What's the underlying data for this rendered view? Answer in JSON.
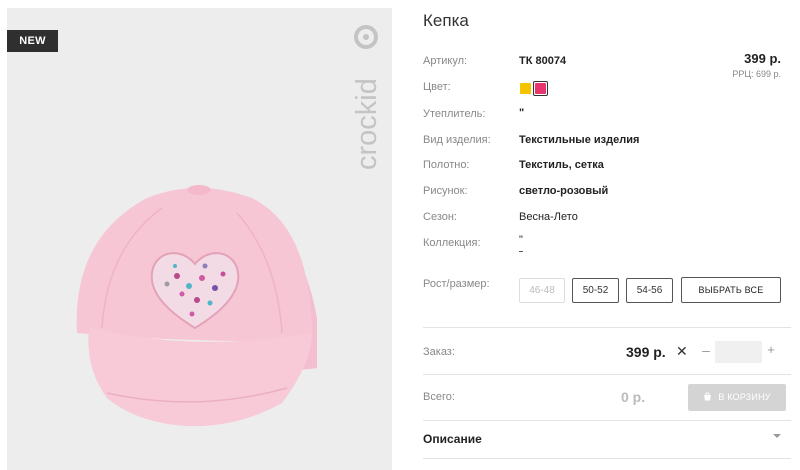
{
  "product": {
    "badge": "NEW",
    "brand": "crockid",
    "title": "Кепка"
  },
  "attributes": [
    {
      "label": "Артикул:",
      "value": "ТК 80074"
    },
    {
      "label": "Цвет:",
      "value": ""
    },
    {
      "label": "Утеплитель:",
      "value": "\""
    },
    {
      "label": "Вид изделия:",
      "value": "Текстильные изделия"
    },
    {
      "label": "Полотно:",
      "value": "Текстиль, сетка"
    },
    {
      "label": "Рисунок:",
      "value": "светло-розовый"
    },
    {
      "label": "Сезон:",
      "value": "Весна-Лето"
    },
    {
      "label": "Коллекция:",
      "value": "\""
    }
  ],
  "colors": [
    "#f5c400",
    "#e8356d"
  ],
  "price": {
    "main": "399 р.",
    "rrc": "РРЦ: 699 р."
  },
  "sizes": {
    "label": "Рост/размер:",
    "options": [
      {
        "label": "46-48",
        "available": false
      },
      {
        "label": "50-52",
        "available": true
      },
      {
        "label": "54-56",
        "available": true
      }
    ],
    "select_all": "ВЫБРАТЬ ВСЕ"
  },
  "order": {
    "label": "Заказ:",
    "price": "399 р.",
    "multiply": "✕",
    "minus": "–",
    "plus": "+",
    "quantity": ""
  },
  "total": {
    "label": "Всего:",
    "value": "0 р.",
    "cart_button": "В КОРЗИНУ"
  },
  "description": {
    "title": "Описание"
  }
}
